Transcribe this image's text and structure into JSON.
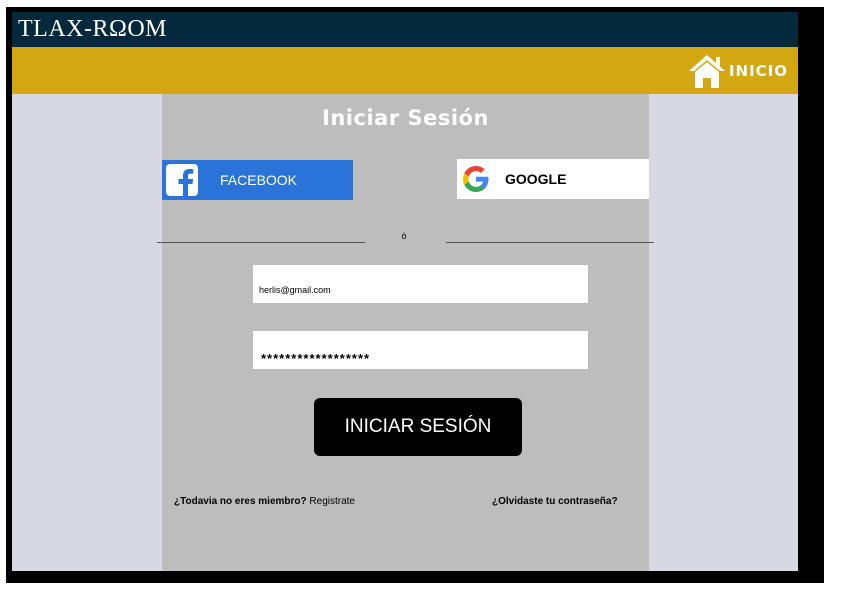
{
  "header": {
    "brand": "TLAX-RΩOM"
  },
  "nav": {
    "home_label": "INICIO",
    "home_icon": "home-icon"
  },
  "login": {
    "title": "Iniciar Sesión",
    "facebook_label": "FACEBOOK",
    "google_label": "GOOGLE",
    "or_text": "ó",
    "email_value": "herlis@gmail.com",
    "password_value": "******************",
    "submit_label": "INICIAR SESIÓN",
    "signup_question": "¿Todavia no eres miembro?",
    "signup_link": "Registrate",
    "forgot_link": "¿Olvidaste tu contraseña?"
  },
  "colors": {
    "topbar": "#04293d",
    "navbar": "#d3a712",
    "panel": "#bdbdbd",
    "background": "#d7d8e2",
    "facebook": "#2a73d8",
    "button": "#000000"
  }
}
